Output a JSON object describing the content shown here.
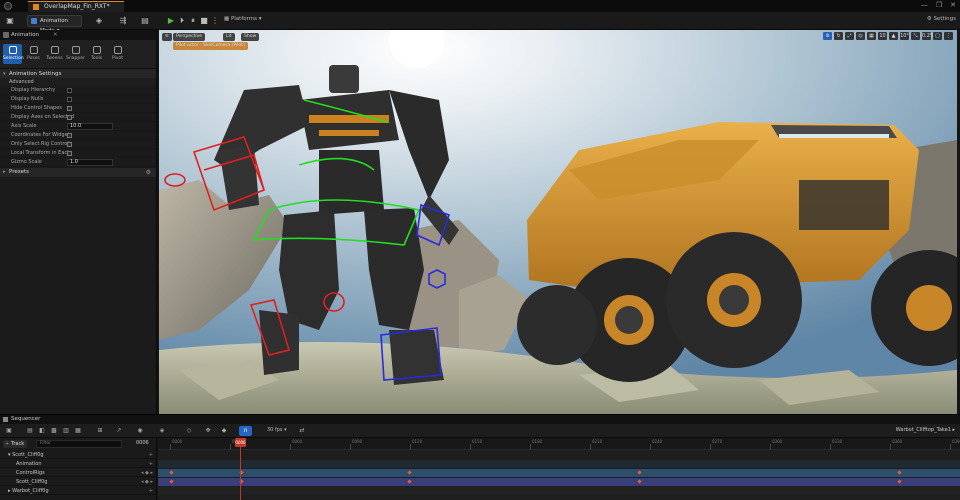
{
  "titlebar": {
    "tab_label": "OverlapMap_Fin_RXT*",
    "window_controls": [
      "—",
      "❐",
      "✕"
    ]
  },
  "toolbar": {
    "mode_label": "Animation Mode",
    "platforms_label": "Platforms",
    "settings_label": "Settings"
  },
  "left_panel": {
    "header": "Animation",
    "tools": [
      {
        "label": "Selection",
        "active": true
      },
      {
        "label": "Poses",
        "active": false
      },
      {
        "label": "Tweens",
        "active": false
      },
      {
        "label": "Snapper",
        "active": false
      },
      {
        "label": "Tools",
        "active": false
      },
      {
        "label": "Pivot",
        "active": false
      }
    ],
    "section_title": "Animation Settings",
    "subsection": "Advanced",
    "properties": [
      {
        "label": "Display Hierarchy",
        "type": "checkbox",
        "value": false
      },
      {
        "label": "Display Nulls",
        "type": "checkbox",
        "value": false
      },
      {
        "label": "Hide Control Shapes",
        "type": "checkbox",
        "value": true
      },
      {
        "label": "Display Axes on Selected",
        "type": "checkbox",
        "value": true
      },
      {
        "label": "Axis Scale",
        "type": "number",
        "value": "10.0"
      },
      {
        "label": "Coordinates For Widget",
        "type": "checkbox",
        "value": true
      },
      {
        "label": "Only Select Rig Controls",
        "type": "checkbox",
        "value": true
      },
      {
        "label": "Local Transform in Each",
        "type": "checkbox",
        "value": true
      },
      {
        "label": "Gizmo Scale",
        "type": "number",
        "value": "1.0"
      }
    ],
    "presets_title": "Presets"
  },
  "viewport": {
    "perspective_label": "Perspective",
    "lit_label": "Lit",
    "show_label": "Show",
    "pilot_label": "Pilot actor - SkelCamera [Pilot]",
    "right_icons": [
      "⊕",
      "↻",
      "⤢",
      "◎",
      "▦",
      "10",
      "▲",
      "10°",
      "⤡",
      "0.25",
      "▢",
      "⋮"
    ]
  },
  "sequencer": {
    "header": "Sequencer",
    "fps": "30 fps",
    "sequence_name": "Warbot_Clifftop_Take1",
    "add_track": "Track",
    "filter_placeholder": "Filter",
    "current_frame": "0006",
    "playhead_label": "0006",
    "tracks": [
      {
        "label": "Scott_Cliff0g",
        "indent": 0
      },
      {
        "label": "Animation",
        "indent": 1
      },
      {
        "label": "ControlRigs",
        "indent": 1
      },
      {
        "label": "Scott_Cliff0g",
        "indent": 1
      },
      {
        "label": "Warbot_Cliff0g",
        "indent": 0
      }
    ],
    "ruler_labels": [
      "0000",
      "0030",
      "0060",
      "0090",
      "0120",
      "0150",
      "0180",
      "0210",
      "0240",
      "0270",
      "0300",
      "0330",
      "0360",
      "0390"
    ]
  },
  "colors": {
    "accent": "#2766c4",
    "playhead": "#c0392b",
    "key": "#e85a3a",
    "control_green": "#22dd22",
    "control_red": "#e02020",
    "control_blue": "#2a2ae0"
  }
}
